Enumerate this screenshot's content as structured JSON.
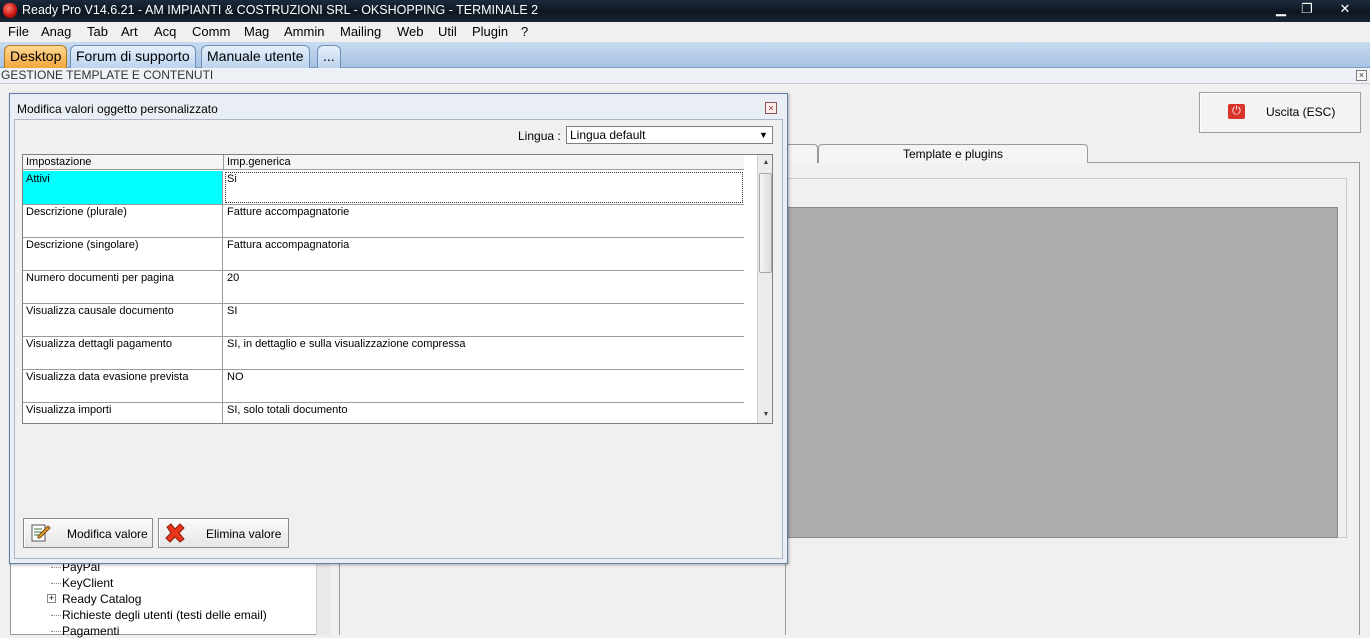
{
  "window": {
    "title": "Ready Pro V14.6.21 - AM IMPIANTI & COSTRUZIONI SRL - OKSHOPPING - TERMINALE 2",
    "minimize": "▁",
    "restore": "❐",
    "close": "✕"
  },
  "menu": [
    "File",
    "Anag",
    "Tab",
    "Art",
    "Acq",
    "Comm",
    "Mag",
    "Ammin",
    "Mailing",
    "Web",
    "Util",
    "Plugin",
    "?"
  ],
  "tabs": [
    {
      "label": "Desktop",
      "active": true
    },
    {
      "label": "Forum di supporto",
      "active": false
    },
    {
      "label": "Manuale utente",
      "active": false
    },
    {
      "label": "...",
      "active": false
    }
  ],
  "section": {
    "title": "GESTIONE TEMPLATE E CONTENUTI",
    "close": "×"
  },
  "exit_button": {
    "label": "Uscita (ESC)",
    "icon": "power-icon"
  },
  "background_tab": {
    "label": "Template e plugins"
  },
  "tree": {
    "items": [
      "PayPal",
      "KeyClient",
      "Ready Catalog",
      "Richieste degli utenti (testi delle email)",
      "Pagamenti"
    ],
    "expander": "+"
  },
  "dialog": {
    "title": "Modifica valori oggetto personalizzato",
    "close": "×",
    "language_label": "Lingua :",
    "language_value": "Lingua default",
    "grid": {
      "headers": [
        "Impostazione",
        "Imp.generica"
      ],
      "rows": [
        {
          "setting": "Attivi",
          "value": "Si",
          "selected": true
        },
        {
          "setting": "Descrizione (plurale)",
          "value": "Fatture accompagnatorie"
        },
        {
          "setting": "Descrizione (singolare)",
          "value": "Fattura accompagnatoria"
        },
        {
          "setting": "Numero documenti per pagina",
          "value": "20"
        },
        {
          "setting": "Visualizza causale documento",
          "value": "SI"
        },
        {
          "setting": "Visualizza dettagli pagamento",
          "value": "SI, in dettaglio e sulla visualizzazione compressa"
        },
        {
          "setting": "Visualizza data evasione prevista",
          "value": "NO"
        },
        {
          "setting": "Visualizza importi",
          "value": "SI, solo totali documento"
        }
      ]
    },
    "buttons": {
      "edit": "Modifica valore",
      "delete": "Elimina valore"
    }
  },
  "colors": {
    "titlebar": "#0d1620",
    "selected_cell": "#00ffff",
    "active_tab": "#f3a63c",
    "tab_bar": "#a6c2e3"
  }
}
